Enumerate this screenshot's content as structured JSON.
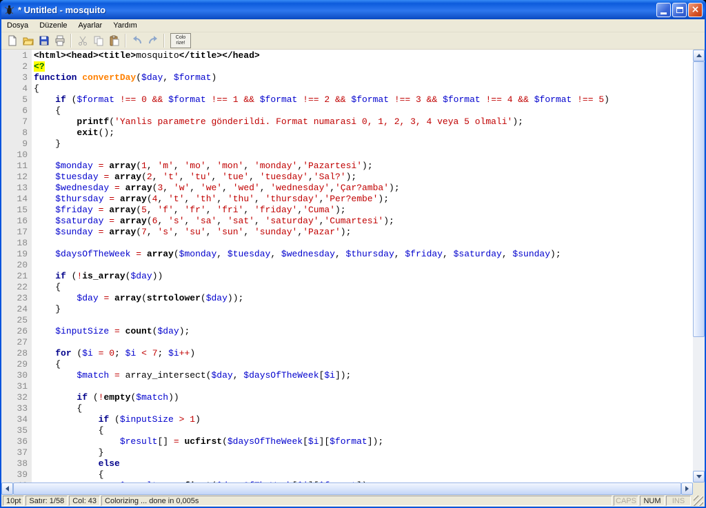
{
  "window": {
    "title": "* Untitled - mosquito",
    "controls": [
      "minimize-icon",
      "maximize-icon",
      "close-icon"
    ]
  },
  "menu": {
    "items": [
      "Dosya",
      "Düzenle",
      "Ayarlar",
      "Yardım"
    ]
  },
  "toolbar": {
    "icons": [
      "new-document-icon",
      "open-folder-icon",
      "save-icon",
      "print-icon",
      "cut-icon",
      "copy-icon",
      "paste-icon",
      "undo-icon",
      "redo-icon"
    ],
    "colorize_line1": "Colo",
    "colorize_line2": "rize!"
  },
  "editor": {
    "syntax_colors": {
      "keyword": "#00008b",
      "builtin_bold": "#000000",
      "variable": "#0000cd",
      "string_number_operator": "#c00000",
      "function_name": "#ff8000",
      "php_open_tag_bg": "#ffff00",
      "php_open_tag_fg": "#007000",
      "line_number": "#8a8a8a",
      "gutter_bg": "#ebebeb"
    },
    "lines": [
      [
        [
          "t",
          "<html><head><title>"
        ],
        [
          "p",
          "mosquito"
        ],
        [
          "t",
          "</title></head>"
        ]
      ],
      [
        [
          "php",
          "<?"
        ]
      ],
      [
        [
          "k",
          "function "
        ],
        [
          "f",
          "convertDay"
        ],
        [
          "p",
          "("
        ],
        [
          "v",
          "$day"
        ],
        [
          "p",
          ", "
        ],
        [
          "v",
          "$format"
        ],
        [
          "p",
          ")"
        ]
      ],
      [
        [
          "p",
          "{"
        ]
      ],
      [
        [
          "p",
          "    "
        ],
        [
          "k",
          "if"
        ],
        [
          "p",
          " ("
        ],
        [
          "v",
          "$format"
        ],
        [
          "o",
          " !== "
        ],
        [
          "n",
          "0"
        ],
        [
          "o",
          " && "
        ],
        [
          "v",
          "$format"
        ],
        [
          "o",
          " !== "
        ],
        [
          "n",
          "1"
        ],
        [
          "o",
          " && "
        ],
        [
          "v",
          "$format"
        ],
        [
          "o",
          " !== "
        ],
        [
          "n",
          "2"
        ],
        [
          "o",
          " && "
        ],
        [
          "v",
          "$format"
        ],
        [
          "o",
          " !== "
        ],
        [
          "n",
          "3"
        ],
        [
          "o",
          " && "
        ],
        [
          "v",
          "$format"
        ],
        [
          "o",
          " !== "
        ],
        [
          "n",
          "4"
        ],
        [
          "o",
          " && "
        ],
        [
          "v",
          "$format"
        ],
        [
          "o",
          " !== "
        ],
        [
          "n",
          "5"
        ],
        [
          "p",
          ")"
        ]
      ],
      [
        [
          "p",
          "    {"
        ]
      ],
      [
        [
          "p",
          "        "
        ],
        [
          "t",
          "printf"
        ],
        [
          "p",
          "("
        ],
        [
          "s",
          "'Yanlis parametre gönderildi. Format numarasi 0, 1, 2, 3, 4 veya 5 olmali'"
        ],
        [
          "p",
          ");"
        ]
      ],
      [
        [
          "p",
          "        "
        ],
        [
          "t",
          "exit"
        ],
        [
          "p",
          "();"
        ]
      ],
      [
        [
          "p",
          "    }"
        ]
      ],
      [],
      [
        [
          "p",
          "    "
        ],
        [
          "v",
          "$monday"
        ],
        [
          "o",
          " = "
        ],
        [
          "t",
          "array"
        ],
        [
          "p",
          "("
        ],
        [
          "n",
          "1"
        ],
        [
          "p",
          ", "
        ],
        [
          "s",
          "'m'"
        ],
        [
          "p",
          ", "
        ],
        [
          "s",
          "'mo'"
        ],
        [
          "p",
          ", "
        ],
        [
          "s",
          "'mon'"
        ],
        [
          "p",
          ", "
        ],
        [
          "s",
          "'monday'"
        ],
        [
          "p",
          ","
        ],
        [
          "s",
          "'Pazartesi'"
        ],
        [
          "p",
          ");"
        ]
      ],
      [
        [
          "p",
          "    "
        ],
        [
          "v",
          "$tuesday"
        ],
        [
          "o",
          " = "
        ],
        [
          "t",
          "array"
        ],
        [
          "p",
          "("
        ],
        [
          "n",
          "2"
        ],
        [
          "p",
          ", "
        ],
        [
          "s",
          "'t'"
        ],
        [
          "p",
          ", "
        ],
        [
          "s",
          "'tu'"
        ],
        [
          "p",
          ", "
        ],
        [
          "s",
          "'tue'"
        ],
        [
          "p",
          ", "
        ],
        [
          "s",
          "'tuesday'"
        ],
        [
          "p",
          ","
        ],
        [
          "s",
          "'Sal?'"
        ],
        [
          "p",
          ");"
        ]
      ],
      [
        [
          "p",
          "    "
        ],
        [
          "v",
          "$wednesday"
        ],
        [
          "o",
          " = "
        ],
        [
          "t",
          "array"
        ],
        [
          "p",
          "("
        ],
        [
          "n",
          "3"
        ],
        [
          "p",
          ", "
        ],
        [
          "s",
          "'w'"
        ],
        [
          "p",
          ", "
        ],
        [
          "s",
          "'we'"
        ],
        [
          "p",
          ", "
        ],
        [
          "s",
          "'wed'"
        ],
        [
          "p",
          ", "
        ],
        [
          "s",
          "'wednesday'"
        ],
        [
          "p",
          ","
        ],
        [
          "s",
          "'Çar?amba'"
        ],
        [
          "p",
          ");"
        ]
      ],
      [
        [
          "p",
          "    "
        ],
        [
          "v",
          "$thursday"
        ],
        [
          "o",
          " = "
        ],
        [
          "t",
          "array"
        ],
        [
          "p",
          "("
        ],
        [
          "n",
          "4"
        ],
        [
          "p",
          ", "
        ],
        [
          "s",
          "'t'"
        ],
        [
          "p",
          ", "
        ],
        [
          "s",
          "'th'"
        ],
        [
          "p",
          ", "
        ],
        [
          "s",
          "'thu'"
        ],
        [
          "p",
          ", "
        ],
        [
          "s",
          "'thursday'"
        ],
        [
          "p",
          ","
        ],
        [
          "s",
          "'Per?embe'"
        ],
        [
          "p",
          ");"
        ]
      ],
      [
        [
          "p",
          "    "
        ],
        [
          "v",
          "$friday"
        ],
        [
          "o",
          " = "
        ],
        [
          "t",
          "array"
        ],
        [
          "p",
          "("
        ],
        [
          "n",
          "5"
        ],
        [
          "p",
          ", "
        ],
        [
          "s",
          "'f'"
        ],
        [
          "p",
          ", "
        ],
        [
          "s",
          "'fr'"
        ],
        [
          "p",
          ", "
        ],
        [
          "s",
          "'fri'"
        ],
        [
          "p",
          ", "
        ],
        [
          "s",
          "'friday'"
        ],
        [
          "p",
          ","
        ],
        [
          "s",
          "'Cuma'"
        ],
        [
          "p",
          ");"
        ]
      ],
      [
        [
          "p",
          "    "
        ],
        [
          "v",
          "$saturday"
        ],
        [
          "o",
          " = "
        ],
        [
          "t",
          "array"
        ],
        [
          "p",
          "("
        ],
        [
          "n",
          "6"
        ],
        [
          "p",
          ", "
        ],
        [
          "s",
          "'s'"
        ],
        [
          "p",
          ", "
        ],
        [
          "s",
          "'sa'"
        ],
        [
          "p",
          ", "
        ],
        [
          "s",
          "'sat'"
        ],
        [
          "p",
          ", "
        ],
        [
          "s",
          "'saturday'"
        ],
        [
          "p",
          ","
        ],
        [
          "s",
          "'Cumartesi'"
        ],
        [
          "p",
          ");"
        ]
      ],
      [
        [
          "p",
          "    "
        ],
        [
          "v",
          "$sunday"
        ],
        [
          "o",
          " = "
        ],
        [
          "t",
          "array"
        ],
        [
          "p",
          "("
        ],
        [
          "n",
          "7"
        ],
        [
          "p",
          ", "
        ],
        [
          "s",
          "'s'"
        ],
        [
          "p",
          ", "
        ],
        [
          "s",
          "'su'"
        ],
        [
          "p",
          ", "
        ],
        [
          "s",
          "'sun'"
        ],
        [
          "p",
          ", "
        ],
        [
          "s",
          "'sunday'"
        ],
        [
          "p",
          ","
        ],
        [
          "s",
          "'Pazar'"
        ],
        [
          "p",
          ");"
        ]
      ],
      [],
      [
        [
          "p",
          "    "
        ],
        [
          "v",
          "$daysOfTheWeek"
        ],
        [
          "o",
          " = "
        ],
        [
          "t",
          "array"
        ],
        [
          "p",
          "("
        ],
        [
          "v",
          "$monday"
        ],
        [
          "p",
          ", "
        ],
        [
          "v",
          "$tuesday"
        ],
        [
          "p",
          ", "
        ],
        [
          "v",
          "$wednesday"
        ],
        [
          "p",
          ", "
        ],
        [
          "v",
          "$thursday"
        ],
        [
          "p",
          ", "
        ],
        [
          "v",
          "$friday"
        ],
        [
          "p",
          ", "
        ],
        [
          "v",
          "$saturday"
        ],
        [
          "p",
          ", "
        ],
        [
          "v",
          "$sunday"
        ],
        [
          "p",
          ");"
        ]
      ],
      [],
      [
        [
          "p",
          "    "
        ],
        [
          "k",
          "if"
        ],
        [
          "p",
          " ("
        ],
        [
          "o",
          "!"
        ],
        [
          "t",
          "is_array"
        ],
        [
          "p",
          "("
        ],
        [
          "v",
          "$day"
        ],
        [
          "p",
          "))"
        ]
      ],
      [
        [
          "p",
          "    {"
        ]
      ],
      [
        [
          "p",
          "        "
        ],
        [
          "v",
          "$day"
        ],
        [
          "o",
          " = "
        ],
        [
          "t",
          "array"
        ],
        [
          "p",
          "("
        ],
        [
          "t",
          "strtolower"
        ],
        [
          "p",
          "("
        ],
        [
          "v",
          "$day"
        ],
        [
          "p",
          "));"
        ]
      ],
      [
        [
          "p",
          "    }"
        ]
      ],
      [],
      [
        [
          "p",
          "    "
        ],
        [
          "v",
          "$inputSize"
        ],
        [
          "o",
          " = "
        ],
        [
          "t",
          "count"
        ],
        [
          "p",
          "("
        ],
        [
          "v",
          "$day"
        ],
        [
          "p",
          ");"
        ]
      ],
      [],
      [
        [
          "p",
          "    "
        ],
        [
          "k",
          "for"
        ],
        [
          "p",
          " ("
        ],
        [
          "v",
          "$i"
        ],
        [
          "o",
          " = "
        ],
        [
          "n",
          "0"
        ],
        [
          "p",
          "; "
        ],
        [
          "v",
          "$i"
        ],
        [
          "o",
          " < "
        ],
        [
          "n",
          "7"
        ],
        [
          "p",
          "; "
        ],
        [
          "v",
          "$i"
        ],
        [
          "o",
          "++"
        ],
        [
          "p",
          ")"
        ]
      ],
      [
        [
          "p",
          "    {"
        ]
      ],
      [
        [
          "p",
          "        "
        ],
        [
          "v",
          "$match"
        ],
        [
          "o",
          " = "
        ],
        [
          "p",
          "array_intersect("
        ],
        [
          "v",
          "$day"
        ],
        [
          "p",
          ", "
        ],
        [
          "v",
          "$daysOfTheWeek"
        ],
        [
          "p",
          "["
        ],
        [
          "v",
          "$i"
        ],
        [
          "p",
          "]);"
        ]
      ],
      [],
      [
        [
          "p",
          "        "
        ],
        [
          "k",
          "if"
        ],
        [
          "p",
          " ("
        ],
        [
          "o",
          "!"
        ],
        [
          "t",
          "empty"
        ],
        [
          "p",
          "("
        ],
        [
          "v",
          "$match"
        ],
        [
          "p",
          "))"
        ]
      ],
      [
        [
          "p",
          "        {"
        ]
      ],
      [
        [
          "p",
          "            "
        ],
        [
          "k",
          "if"
        ],
        [
          "p",
          " ("
        ],
        [
          "v",
          "$inputSize"
        ],
        [
          "o",
          " > "
        ],
        [
          "n",
          "1"
        ],
        [
          "p",
          ")"
        ]
      ],
      [
        [
          "p",
          "            {"
        ]
      ],
      [
        [
          "p",
          "                "
        ],
        [
          "v",
          "$result"
        ],
        [
          "p",
          "[]"
        ],
        [
          "o",
          " = "
        ],
        [
          "t",
          "ucfirst"
        ],
        [
          "p",
          "("
        ],
        [
          "v",
          "$daysOfTheWeek"
        ],
        [
          "p",
          "["
        ],
        [
          "v",
          "$i"
        ],
        [
          "p",
          "]["
        ],
        [
          "v",
          "$format"
        ],
        [
          "p",
          "]);"
        ]
      ],
      [
        [
          "p",
          "            }"
        ]
      ],
      [
        [
          "p",
          "            "
        ],
        [
          "k",
          "else"
        ]
      ],
      [
        [
          "p",
          "            {"
        ]
      ],
      [
        [
          "p",
          "                "
        ],
        [
          "v",
          "$result"
        ],
        [
          "o",
          " = "
        ],
        [
          "t",
          "ucfirst"
        ],
        [
          "p",
          "("
        ],
        [
          "v",
          "$daysOfTheWeek"
        ],
        [
          "p",
          "["
        ],
        [
          "v",
          "$i"
        ],
        [
          "p",
          "]["
        ],
        [
          "v",
          "$format"
        ],
        [
          "p",
          "]);"
        ]
      ]
    ]
  },
  "statusbar": {
    "font_size": "10pt",
    "position": "Satır: 1/58",
    "column": "Col: 43",
    "message": "Colorizing ... done in 0,005s",
    "caps": "CAPS",
    "num": "NUM",
    "ins": "INS"
  }
}
